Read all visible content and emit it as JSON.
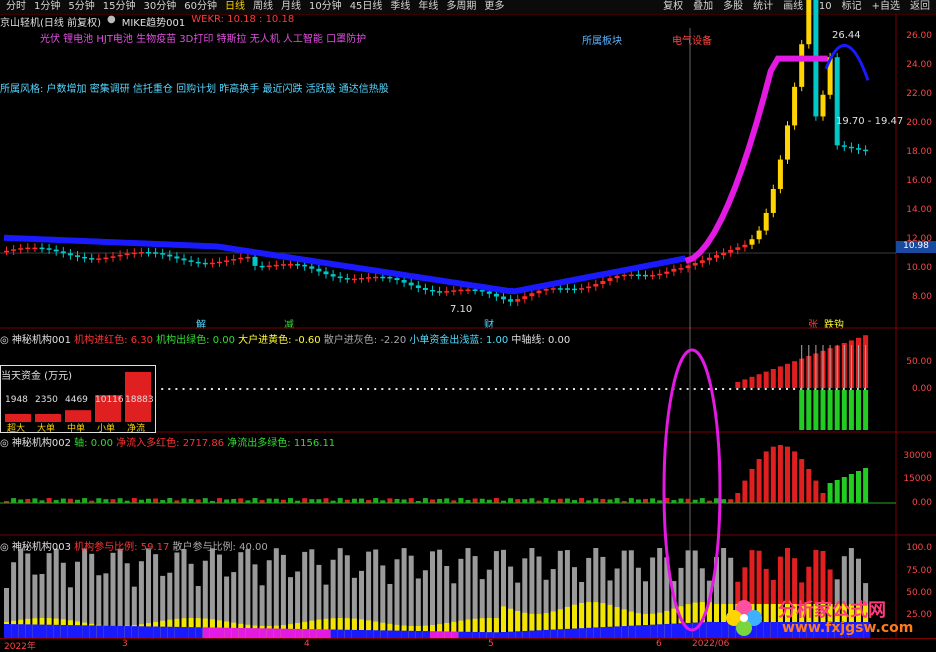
{
  "toolbar": {
    "periods": [
      "分时",
      "1分钟",
      "5分钟",
      "15分钟",
      "30分钟",
      "60分钟",
      "日线",
      "周线",
      "月线",
      "10分钟",
      "45日线",
      "季线",
      "年线",
      "多周期",
      "更多"
    ],
    "active_period": "日线",
    "right_buttons": [
      "复权",
      "叠加",
      "多股",
      "统计",
      "画线",
      "F10",
      "标记",
      "+自选",
      "返回"
    ]
  },
  "header": {
    "stock": "京山轻机(日线 前复权)",
    "indicator": "MIKE趋势001",
    "wekr": "WEKR: 10.18 : 10.18"
  },
  "concepts": "光伏 锂电池 HJT电池 生物疫苗 3D打印 特斯拉 无人机 人工智能 口罩防护",
  "style_line": "所属风格: 户数增加 密集调研 信托重仓 回购计划 昨高换手 最近闪跌 活跃股 通达信热股",
  "tags": {
    "sector": "所属板块",
    "electric": "电气设备",
    "jie": "解",
    "jian": "减",
    "cai": "财",
    "zhang": "张",
    "dagou": "跌钩"
  },
  "main_axis": [
    "26.00",
    "24.00",
    "22.00",
    "20.00",
    "18.00",
    "16.00",
    "14.00",
    "12.00",
    "10.00",
    "8.00"
  ],
  "price_markers": {
    "high": "26.44",
    "low": "7.10",
    "current": "10.98",
    "range": "19.70 - 19.47"
  },
  "panel1": {
    "title": "神秘机构001",
    "items": [
      {
        "label": "机构进红色:",
        "value": "6.30",
        "color": "#ff3333"
      },
      {
        "label": "机构出绿色:",
        "value": "0.00",
        "color": "#33dd33"
      },
      {
        "label": "大户进黄色:",
        "value": "-0.60",
        "color": "#ffff33"
      },
      {
        "label": "散户进灰色:",
        "value": "-2.20",
        "color": "#aaaaaa"
      },
      {
        "label": "小单资金出浅蓝:",
        "value": "1.00",
        "color": "#55ddff"
      },
      {
        "label": "中轴线:",
        "value": "0.00",
        "color": "#e0e0e0"
      }
    ],
    "axis": [
      "50.00",
      "0.00"
    ]
  },
  "cash_box": {
    "title": "当天资金 (万元)",
    "values": [
      "1948",
      "2350",
      "4469",
      "10116",
      "18883"
    ],
    "labels": [
      "超大",
      "大单",
      "中单",
      "小单",
      "净流"
    ]
  },
  "panel2": {
    "title": "神秘机构002",
    "items": [
      {
        "label": "轴:",
        "value": "0.00",
        "color": "#33dd33"
      },
      {
        "label": "净流入多红色:",
        "value": "2717.86",
        "color": "#ff3333"
      },
      {
        "label": "净流出多绿色:",
        "value": "1156.11",
        "color": "#33dd33"
      }
    ],
    "axis": [
      "30000",
      "15000",
      "0.00"
    ]
  },
  "panel3": {
    "title": "神秘机构003",
    "items": [
      {
        "label": "机构参与比例:",
        "value": "59.17",
        "color": "#ff3333"
      },
      {
        "label": "散户参与比例:",
        "value": "40.00",
        "color": "#aaaaaa"
      }
    ],
    "axis": [
      "100.0",
      "75.00",
      "50.00",
      "25.00"
    ]
  },
  "footer": {
    "labels": [
      "2022年",
      "3",
      "4",
      "5",
      "6",
      "2022/06"
    ]
  },
  "watermark": {
    "cn": "分析家公式网",
    "url": "www.fxjgsw.com"
  },
  "colors": {
    "up": "#ff2a2a",
    "down": "#00c8c8",
    "mike": "#1a1aff",
    "trend": "#e21ae2",
    "ellipse": "#e21ae2"
  }
}
